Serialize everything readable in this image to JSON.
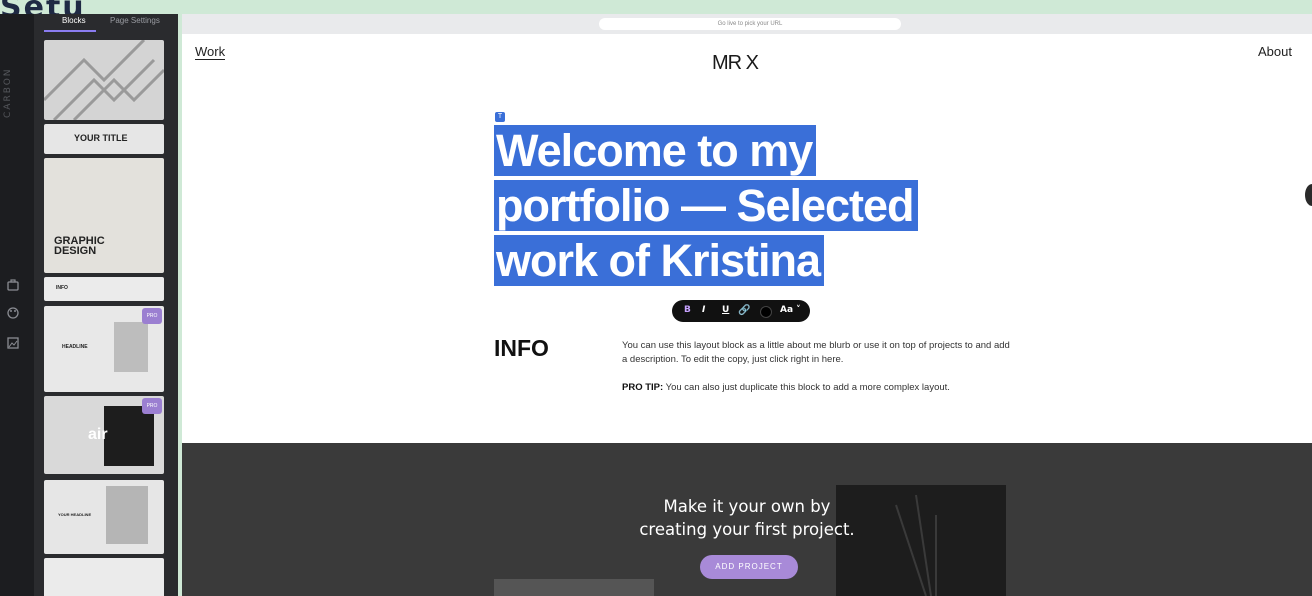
{
  "background_text": "Setu",
  "rail": {
    "brand": "CARBON",
    "icons": [
      "briefcase-icon",
      "palette-icon",
      "image-icon"
    ]
  },
  "panel": {
    "tabs": [
      {
        "label": "Blocks"
      },
      {
        "label": "Page Settings"
      }
    ],
    "thumbs": [
      {
        "name": "pattern",
        "label": ""
      },
      {
        "name": "your-title",
        "label": "YOUR TITLE"
      },
      {
        "name": "graphic-design",
        "label": "GRAPHIC DESIGN"
      },
      {
        "name": "info",
        "label": "INFO"
      },
      {
        "name": "headline",
        "label": "HEADLINE",
        "badge": "PRO"
      },
      {
        "name": "air",
        "label": "air",
        "badge": "PRO"
      },
      {
        "name": "your-headline",
        "label": "YOUR HEADLINE"
      },
      {
        "name": "text",
        "label": ""
      }
    ]
  },
  "canvas": {
    "url_hint": "Go live to pick your URL",
    "nav": {
      "work": "Work",
      "site_name": "MR X",
      "about": "About"
    },
    "headline_lines": [
      "Welcome to my",
      "portfolio — Selected",
      "work of Kristina"
    ],
    "toolbar": {
      "bold": "B",
      "italic": "I",
      "underline": "U",
      "link": "🔗",
      "font": "Aa ˅"
    },
    "info": {
      "heading": "INFO",
      "paragraph": "You can use this layout block as a little about me blurb or use it on top of projects to and add a description. To edit the copy, just click right in here.",
      "pro_tip_label": "PRO TIP:",
      "pro_tip_text": " You can also just duplicate this block to add a more complex layout."
    },
    "cta": {
      "line1": "Make it your own by",
      "line2": "creating your first project.",
      "button": "ADD PROJECT"
    }
  }
}
